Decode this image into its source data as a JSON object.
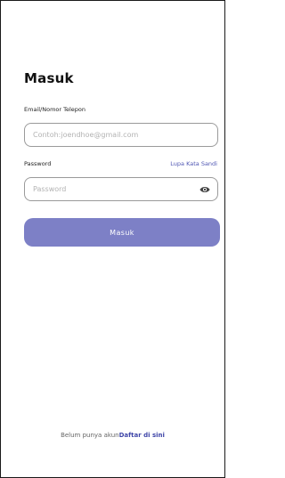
{
  "login": {
    "title": "Masuk",
    "email_label": "Email/Nomor Telepon",
    "email_placeholder": "Contoh:joendhoe@gmail.com",
    "password_label": "Password",
    "forgot_link": "Lupa Kata Sandi",
    "password_placeholder": "Password",
    "submit_label": "Masuk",
    "show_password_icon": "eye-icon"
  },
  "footer": {
    "prompt_text": "Belum punya akun",
    "register_link": "Daftar di sini"
  },
  "colors": {
    "button": "#7d80c6",
    "link": "#3f46a8"
  }
}
